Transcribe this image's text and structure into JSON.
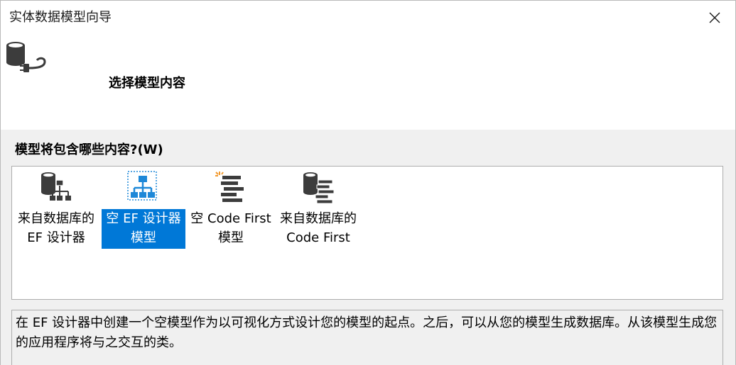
{
  "window": {
    "title": "实体数据模型向导"
  },
  "header": {
    "step_title": "选择模型内容"
  },
  "content": {
    "question": "模型将包含哪些内容?(W)",
    "items": [
      {
        "line1": "来自数据库的",
        "line2": "EF 设计器",
        "icon": "database-hierarchy-icon",
        "selected": false
      },
      {
        "line1": "空 EF 设计器",
        "line2": "模型",
        "icon": "empty-ef-designer-icon",
        "selected": true
      },
      {
        "line1": "空 Code First",
        "line2": "模型",
        "icon": "empty-code-first-icon",
        "selected": false
      },
      {
        "line1": "来自数据库的",
        "line2": "Code First",
        "icon": "database-code-first-icon",
        "selected": false
      }
    ],
    "description": "在 EF 设计器中创建一个空模型作为以可视化方式设计您的模型的起点。之后，可以从您的模型生成数据库。从该模型生成您的应用程序将与之交互的类。"
  },
  "colors": {
    "selection": "#0078d7",
    "content_bg": "#f0f0f0",
    "icon_dark": "#3c3c3c",
    "icon_blue": "#1e88d8",
    "icon_orange": "#f29a2e"
  }
}
